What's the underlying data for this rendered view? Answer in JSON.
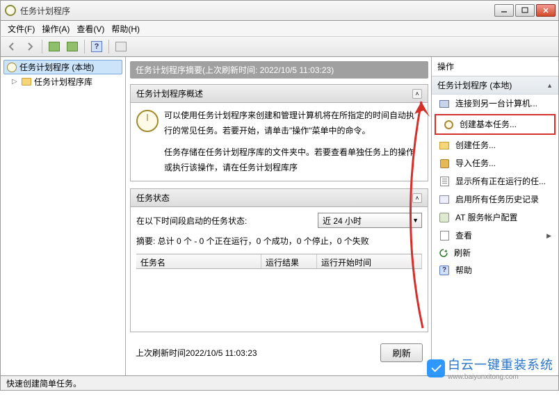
{
  "window": {
    "title": "任务计划程序"
  },
  "menu": {
    "file": "文件(F)",
    "action": "操作(A)",
    "view": "查看(V)",
    "help": "帮助(H)"
  },
  "tree": {
    "root": "任务计划程序 (本地)",
    "child": "任务计划程序库"
  },
  "content": {
    "summary_header": "任务计划程序摘要(上次刷新时间: 2022/10/5 11:03:23)",
    "overview_title": "任务计划程序概述",
    "overview_p1": "可以使用任务计划程序来创建和管理计算机将在所指定的时间自动执行的常见任务。若要开始，请单击\"操作\"菜单中的命令。",
    "overview_p2": "任务存储在任务计划程序库的文件夹中。若要查看单独任务上的操作或执行该操作，请在任务计划程库序",
    "status_title": "任务状态",
    "status_label": "在以下时间段启动的任务状态:",
    "status_select": "近 24 小时",
    "summary_text": "摘要: 总计 0 个 - 0 个正在运行，0 个成功，0 个停止，0 个失败",
    "col_name": "任务名",
    "col_result": "运行结果",
    "col_start": "运行开始时间",
    "last_refresh": "上次刷新时间2022/10/5 11:03:23",
    "refresh_btn": "刷新"
  },
  "actions": {
    "title": "操作",
    "sub": "任务计划程序 (本地)",
    "items": [
      "连接到另一台计算机...",
      "创建基本任务...",
      "创建任务...",
      "导入任务...",
      "显示所有正在运行的任...",
      "启用所有任务历史记录",
      "AT 服务帐户配置",
      "查看",
      "刷新",
      "帮助"
    ]
  },
  "statusbar": "快速创建简单任务。",
  "watermark": {
    "text": "白云一键重装系统",
    "url": "www.baiyunxitong.com"
  }
}
